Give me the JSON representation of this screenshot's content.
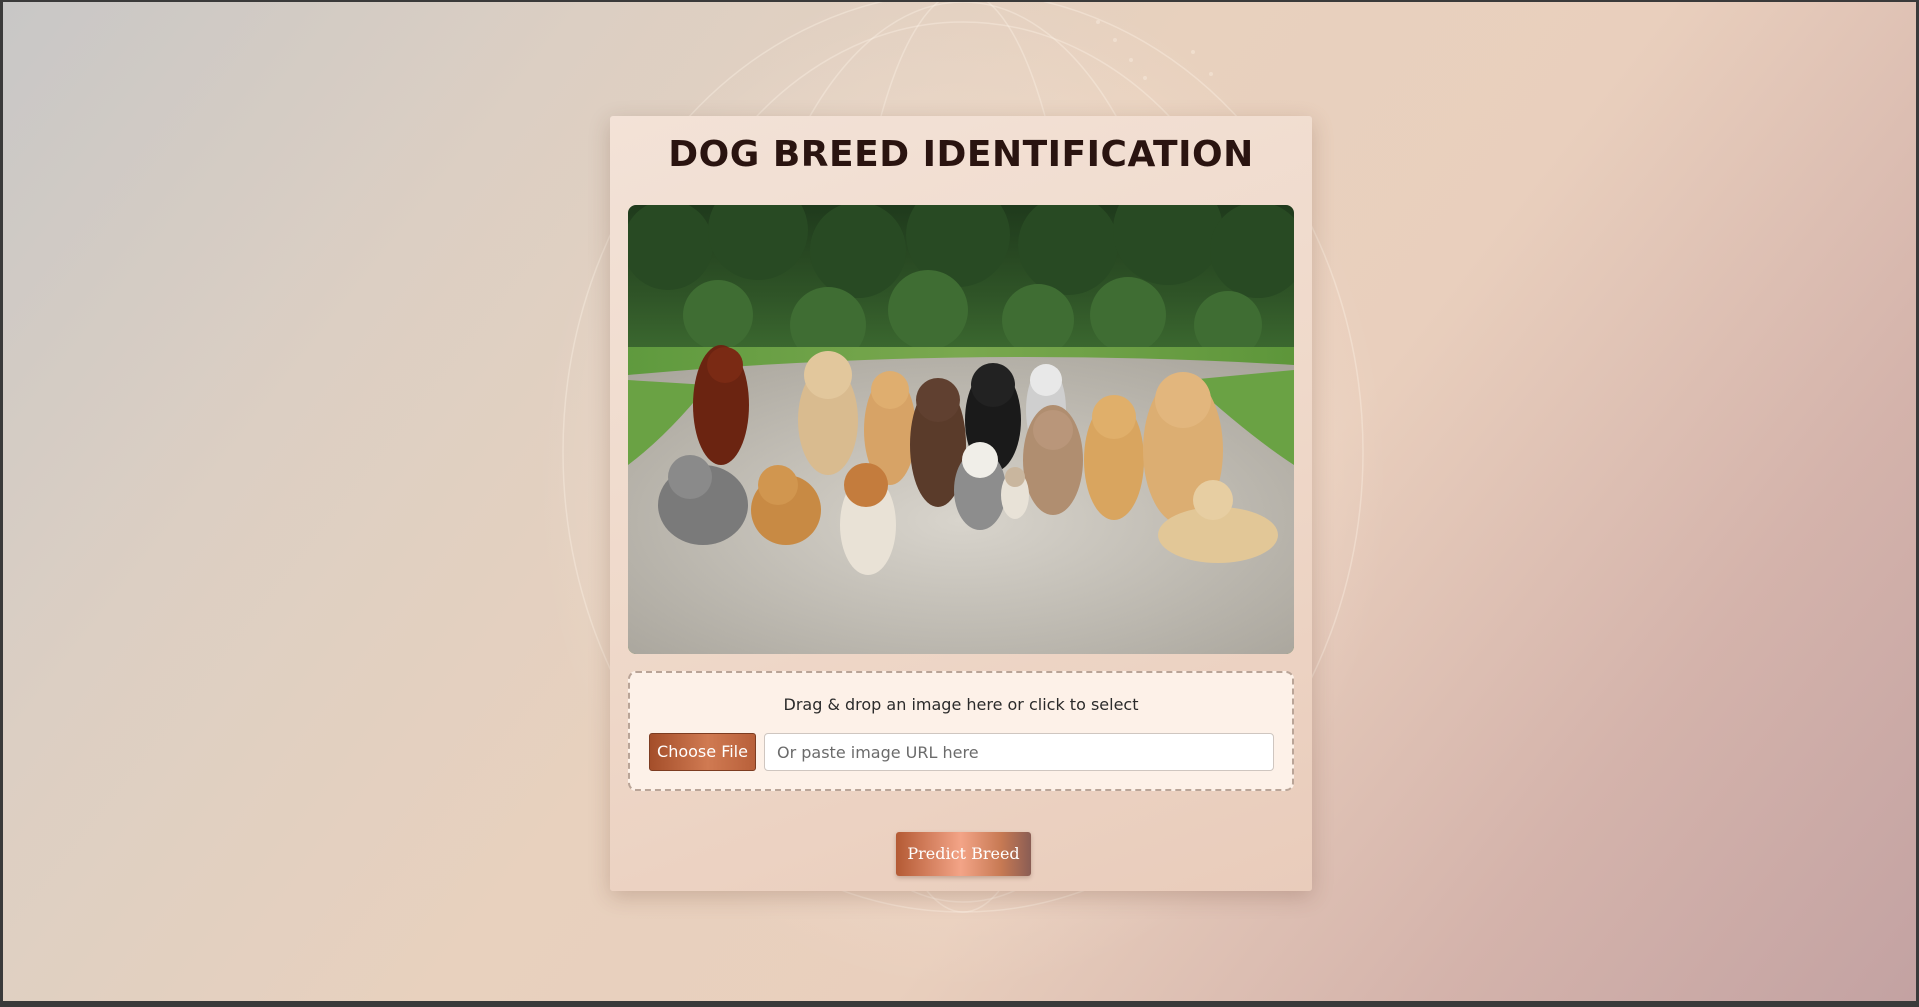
{
  "page": {
    "title": "DOG BREED IDENTIFICATION"
  },
  "upload": {
    "drop_hint": "Drag & drop an image here or click to select",
    "choose_file_label": "Choose File",
    "url_placeholder": "Or paste image URL here",
    "url_value": ""
  },
  "actions": {
    "predict_label": "Predict Breed"
  },
  "colors": {
    "accent": "#b45a34",
    "title_text": "#2a1410",
    "card_background": "#efd9ca",
    "dropzone_background": "#fdf1e8"
  }
}
